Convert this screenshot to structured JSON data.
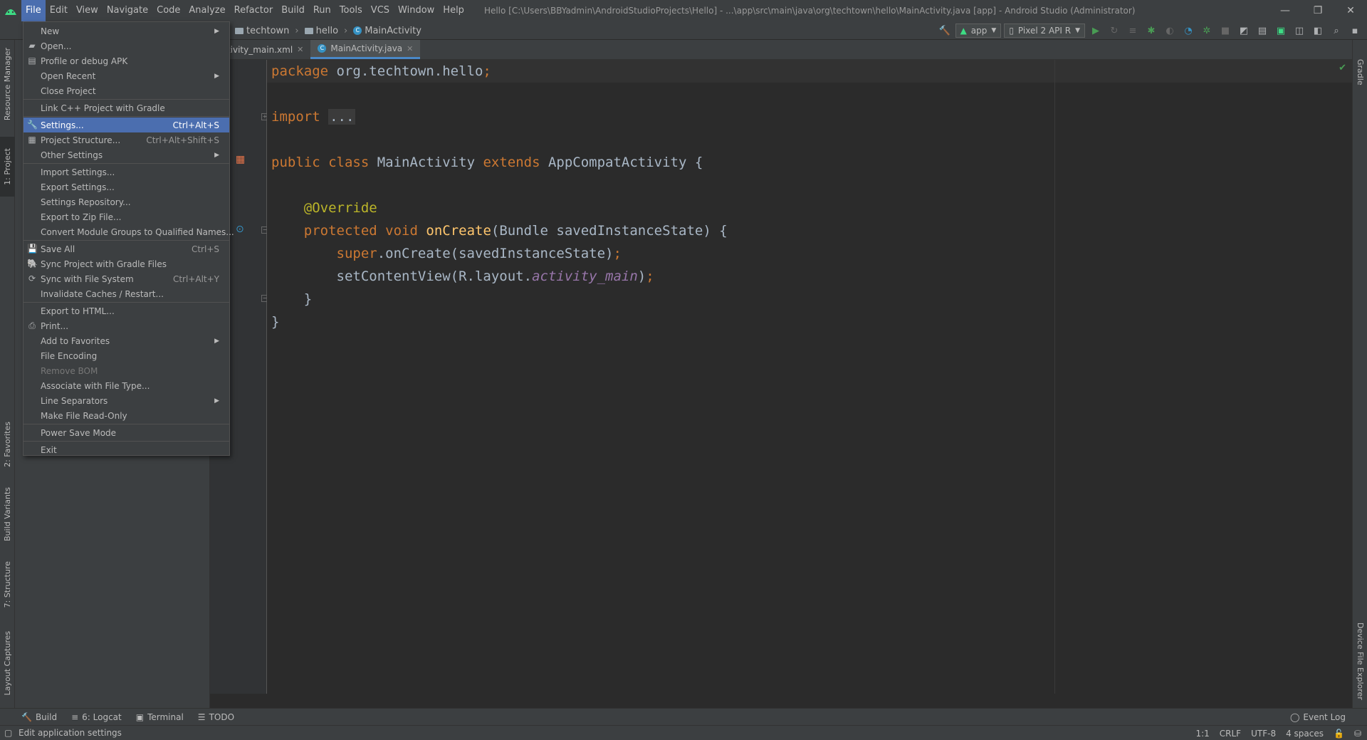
{
  "titlebar": {
    "menus": [
      "File",
      "Edit",
      "View",
      "Navigate",
      "Code",
      "Analyze",
      "Refactor",
      "Build",
      "Run",
      "Tools",
      "VCS",
      "Window",
      "Help"
    ],
    "active_menu": "File",
    "window_title": "Hello [C:\\Users\\BBYadmin\\AndroidStudioProjects\\Hello] - ...\\app\\src\\main\\java\\org\\techtown\\hello\\MainActivity.java [app] - Android Studio (Administrator)",
    "minimize": "—",
    "restore": "❐",
    "close": "✕"
  },
  "breadcrumb": {
    "items": [
      "techtown",
      "hello",
      "MainActivity"
    ]
  },
  "toolbar": {
    "run_config": "app",
    "device": "Pixel 2 API R"
  },
  "left_stripe": {
    "resource_manager": "Resource Manager",
    "project": "1: Project",
    "favorites": "2: Favorites",
    "build_variants": "Build Variants",
    "structure": "7: Structure",
    "layout_captures": "Layout Captures"
  },
  "right_stripe": {
    "gradle": "Gradle",
    "device_file_explorer": "Device File Explorer"
  },
  "editor": {
    "tabs": [
      {
        "label": "activity_main.xml",
        "close": "✕"
      },
      {
        "label": "MainActivity.java",
        "close": "✕"
      }
    ],
    "code": {
      "l1_kw": "package",
      "l1_rest": " org.techtown.hello",
      "l1_semi": ";",
      "l2_kw": "import",
      "l2_fold": "...",
      "l3_kw1": "public",
      "l3_kw2": "class",
      "l3_name": " MainActivity ",
      "l3_kw3": "extends",
      "l3_rest": " AppCompatActivity {",
      "l4_ann": "@Override",
      "l5_kw1": "protected",
      "l5_kw2": "void",
      "l5_fn": "onCreate",
      "l5_rest": "(Bundle savedInstanceState) {",
      "l6_kw": "super",
      "l6_rest": ".onCreate(savedInstanceState)",
      "l6_semi": ";",
      "l7_pre": "setContentView(R.layout.",
      "l7_fld": "activity_main",
      "l7_post": ")",
      "l7_semi": ";",
      "l8": "}",
      "l9": "}"
    }
  },
  "file_menu": {
    "items": [
      {
        "label": "New",
        "submenu": true
      },
      {
        "label": "Open...",
        "icon": "folder-icon"
      },
      {
        "label": "Profile or debug APK",
        "icon": "apk-icon"
      },
      {
        "label": "Open Recent",
        "submenu": true
      },
      {
        "label": "Close Project"
      },
      {
        "label": "Link C++ Project with Gradle"
      },
      {
        "label": "Settings...",
        "shortcut": "Ctrl+Alt+S",
        "icon": "wrench-icon",
        "selected": true
      },
      {
        "label": "Project Structure...",
        "shortcut": "Ctrl+Alt+Shift+S",
        "icon": "project-structure-icon"
      },
      {
        "label": "Other Settings",
        "submenu": true
      },
      {
        "label": "Import Settings..."
      },
      {
        "label": "Export Settings..."
      },
      {
        "label": "Settings Repository..."
      },
      {
        "label": "Export to Zip File..."
      },
      {
        "label": "Convert Module Groups to Qualified Names..."
      },
      {
        "label": "Save All",
        "shortcut": "Ctrl+S",
        "icon": "save-icon"
      },
      {
        "label": "Sync Project with Gradle Files",
        "icon": "gradle-sync-icon"
      },
      {
        "label": "Sync with File System",
        "shortcut": "Ctrl+Alt+Y",
        "icon": "refresh-icon"
      },
      {
        "label": "Invalidate Caches / Restart..."
      },
      {
        "label": "Export to HTML..."
      },
      {
        "label": "Print...",
        "icon": "print-icon"
      },
      {
        "label": "Add to Favorites",
        "submenu": true
      },
      {
        "label": "File Encoding"
      },
      {
        "label": "Remove BOM",
        "disabled": true
      },
      {
        "label": "Associate with File Type..."
      },
      {
        "label": "Line Separators",
        "submenu": true
      },
      {
        "label": "Make File Read-Only"
      },
      {
        "label": "Power Save Mode"
      },
      {
        "label": "Exit"
      }
    ]
  },
  "bottom_tools": {
    "build": "Build",
    "logcat": "6: Logcat",
    "terminal": "Terminal",
    "todo": "TODO",
    "event_log": "Event Log"
  },
  "statusbar": {
    "message": "Edit application settings",
    "position": "1:1",
    "line_sep": "CRLF",
    "encoding": "UTF-8",
    "indent": "4 spaces"
  },
  "colors": {
    "accent": "#4b6eaf",
    "android_green": "#3ddc84",
    "keyword": "#cc7832",
    "annotation": "#bbb529",
    "method": "#ffc66d",
    "field": "#9876aa"
  }
}
